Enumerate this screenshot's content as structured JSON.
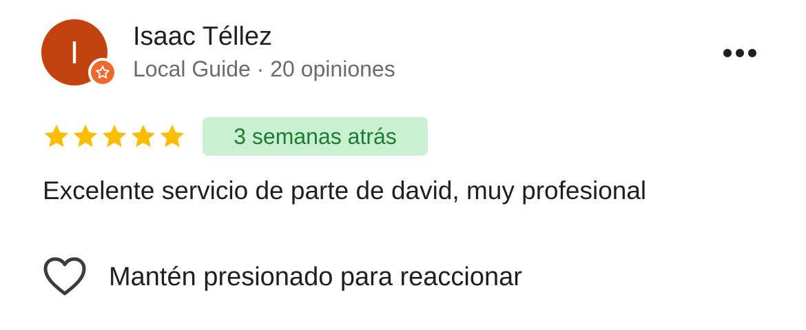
{
  "author": {
    "initial": "I",
    "name": "Isaac Téllez",
    "meta": "Local Guide · 20 opiniones",
    "avatar_color": "#c4420e",
    "badge_color": "#ee6a2c",
    "badge_icon": "star-icon"
  },
  "menu": {
    "icon": "more-horizontal-icon"
  },
  "rating": {
    "stars": 5,
    "max_stars": 5,
    "star_color": "#fbbc04",
    "date": "3 semanas atrás",
    "date_chip_bg": "#c9f1d1",
    "date_chip_text_color": "#1f7a34"
  },
  "review": {
    "text": "Excelente servicio de parte de david, muy profesional"
  },
  "reaction": {
    "icon": "heart-outline-icon",
    "label": "Mantén presionado para reaccionar"
  }
}
